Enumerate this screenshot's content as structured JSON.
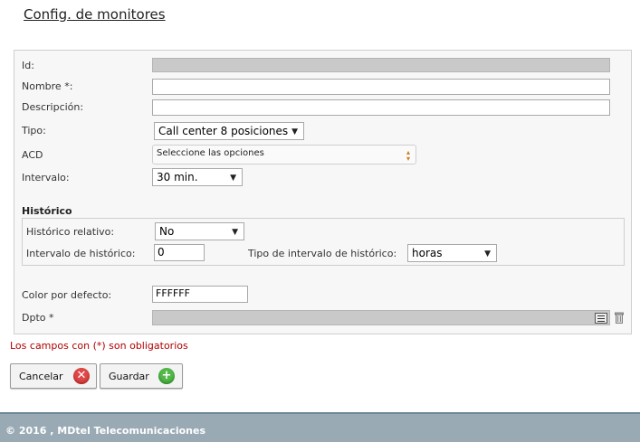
{
  "page": {
    "title": "Config. de monitores"
  },
  "form": {
    "id": {
      "label": "Id:",
      "value": ""
    },
    "nombre": {
      "label": "Nombre *:",
      "value": ""
    },
    "descripcion": {
      "label": "Descripción:",
      "value": ""
    },
    "tipo": {
      "label": "Tipo:",
      "value": "Call center 8 posiciones"
    },
    "acd": {
      "label": "ACD",
      "value": "Seleccione las opciones"
    },
    "intervalo": {
      "label": "Intervalo:",
      "value": "30 min."
    },
    "historico": {
      "title": "Histórico",
      "relativo": {
        "label": "Histórico relativo:",
        "value": "No"
      },
      "intervalo": {
        "label": "Intervalo de histórico:",
        "value": "0"
      },
      "tipo_intervalo": {
        "label": "Tipo de intervalo de histórico:",
        "value": "horas"
      }
    },
    "color": {
      "label": "Color por defecto:",
      "value": "FFFFFF"
    },
    "dpto": {
      "label": "Dpto *",
      "value": ""
    }
  },
  "required_note": "Los campos con (*) son obligatorios",
  "buttons": {
    "cancel": {
      "label": "Cancelar",
      "icon": "cancel-icon",
      "color": "#e04848"
    },
    "save": {
      "label": "Guardar",
      "icon": "add-icon",
      "color": "#55b84a"
    }
  },
  "footer": {
    "text": "© 2016 , MDtel Telecomunicaciones"
  },
  "colors": {
    "footer_bg": "#99aab5",
    "required_text": "#b00000"
  }
}
